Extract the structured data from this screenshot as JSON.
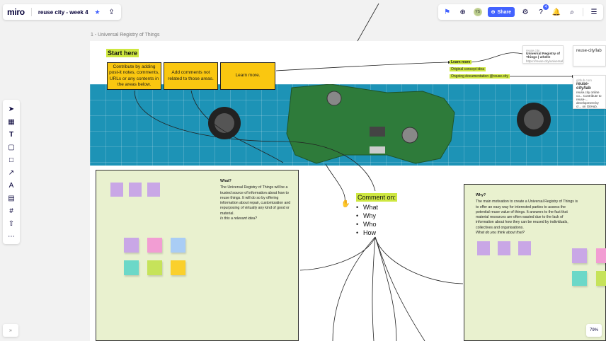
{
  "app": {
    "logo": "miro",
    "board_title": "reuse city - week 4"
  },
  "frame": {
    "label": "1 - Universal Registry of Things"
  },
  "header_actions": {
    "share_label": "Share",
    "notification_count": "4",
    "avatar_initials": "YS"
  },
  "intro": {
    "start_here": "Start here",
    "boxes": [
      "Contribute by adding post-it notes, comments, URLs or any contents in the areas below.",
      "Add comments not related to those areas.",
      "Learn more."
    ]
  },
  "links": {
    "learn_more": "Learn more",
    "original_concept": "Original concept idea",
    "ongoing_doc": "Ongoing documentation @reuse.city"
  },
  "cards": {
    "card1_source": "reuse.city",
    "card1_title": "Universal Registry of Things | whelle",
    "card1_url": "https://reuse.city/universal",
    "card2_title": "reuse-city/lab",
    "card3_source": "github.com",
    "card3_title": "reuse-city/lab",
    "card3_desc": "reuse.city online co... Contribute to reuse-... development by cr... on GitHub."
  },
  "what_panel": {
    "heading": "What?",
    "body": "The Universal Registry of Things will be a trusted source of information about how to reuse things. It will do so by offering information about repair, customization and repurposing of virtually any kind of good or material.",
    "question": "Is this a relevant idea?"
  },
  "why_panel": {
    "heading": "Why?",
    "body": "The main motivation to create a Universal Registry of Things is to offer an easy way for interested parties to assess the potential reuse value of things. It answers to the fact that material resources are often wasted due to the lack of information about how they can be reused by individuals, collectives and organisations.",
    "question": "What do you think about that?"
  },
  "comment": {
    "title": "Comment on:",
    "items": [
      "What",
      "Why",
      "Who",
      "How"
    ]
  },
  "zoom_level": "79%",
  "colors": {
    "accent": "#4262ff",
    "sticky_yellow": "#fac710",
    "highlight": "#cee741",
    "panel_bg": "#e9f1cf"
  }
}
